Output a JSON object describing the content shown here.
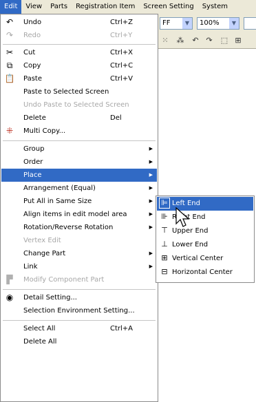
{
  "menubar": {
    "items": [
      "Edit",
      "View",
      "Parts",
      "Registration Item",
      "Screen Setting",
      "System"
    ]
  },
  "toolbar": {
    "combo1": "FF",
    "combo2": "100%"
  },
  "menu": {
    "items": [
      {
        "label": "Undo",
        "shortcut": "Ctrl+Z",
        "icon": "undo-icon",
        "disabled": false
      },
      {
        "label": "Redo",
        "shortcut": "Ctrl+Y",
        "icon": "redo-icon",
        "disabled": true
      },
      {
        "label": "Cut",
        "shortcut": "Ctrl+X",
        "icon": "scissors-icon",
        "disabled": false
      },
      {
        "label": "Copy",
        "shortcut": "Ctrl+C",
        "icon": "copy-icon",
        "disabled": false
      },
      {
        "label": "Paste",
        "shortcut": "Ctrl+V",
        "icon": "paste-icon",
        "disabled": false
      },
      {
        "label": "Paste to Selected Screen",
        "disabled": false
      },
      {
        "label": "Undo Paste to Selected Screen",
        "disabled": true
      },
      {
        "label": "Delete",
        "shortcut": "Del",
        "disabled": false
      },
      {
        "label": "Multi Copy...",
        "icon": "multi-copy-icon",
        "disabled": false
      },
      {
        "label": "Group",
        "submenu": true
      },
      {
        "label": "Order",
        "submenu": true
      },
      {
        "label": "Place",
        "submenu": true,
        "highlighted": true
      },
      {
        "label": "Arrangement (Equal)",
        "submenu": true
      },
      {
        "label": "Put All in Same Size",
        "submenu": true
      },
      {
        "label": "Align items in edit model area",
        "submenu": true
      },
      {
        "label": "Rotation/Reverse Rotation",
        "submenu": true
      },
      {
        "label": "Vertex Edit",
        "disabled": true
      },
      {
        "label": "Change Part",
        "submenu": true
      },
      {
        "label": "Link",
        "submenu": true
      },
      {
        "label": "Modify Component Part",
        "icon": "component-icon",
        "disabled": true
      },
      {
        "label": "Detail Setting...",
        "icon": "detail-icon"
      },
      {
        "label": "Selection Environment Setting..."
      },
      {
        "label": "Select All",
        "shortcut": "Ctrl+A"
      },
      {
        "label": "Delete All"
      }
    ]
  },
  "submenu": {
    "items": [
      {
        "label": "Left End",
        "icon": "align-left-icon",
        "highlighted": true
      },
      {
        "label": "Right End",
        "icon": "align-right-icon"
      },
      {
        "label": "Upper End",
        "icon": "align-top-icon"
      },
      {
        "label": "Lower End",
        "icon": "align-bottom-icon"
      },
      {
        "label": "Vertical Center",
        "icon": "align-vcenter-icon"
      },
      {
        "label": "Horizontal Center",
        "icon": "align-hcenter-icon"
      }
    ]
  },
  "colors": {
    "highlight": "#316ac5",
    "menubar": "#ece9d8",
    "disabled": "#a7a7a7"
  }
}
